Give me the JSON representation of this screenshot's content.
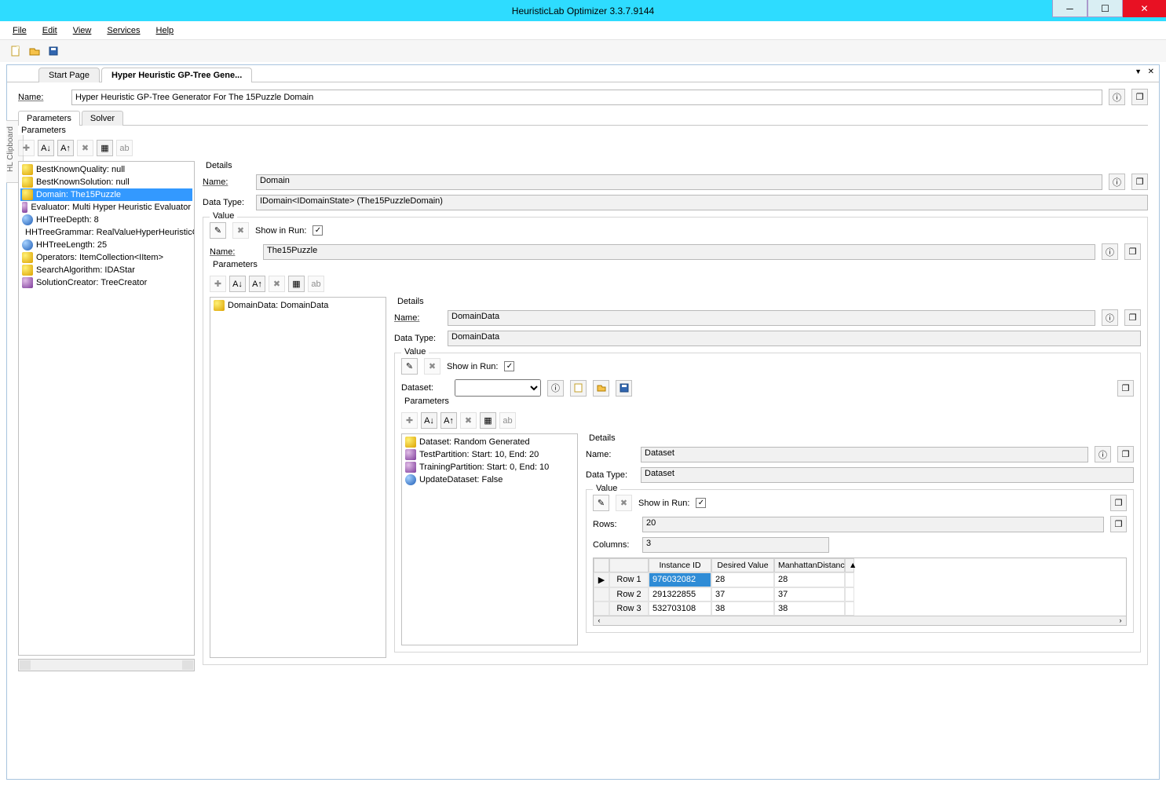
{
  "window": {
    "title": "HeuristicLab Optimizer 3.3.7.9144"
  },
  "menu": {
    "file": "File",
    "edit": "Edit",
    "view": "View",
    "services": "Services",
    "help": "Help"
  },
  "sidebar": {
    "clipboard": "HL Clipboard"
  },
  "tabs": {
    "start": "Start Page",
    "active": "Hyper Heuristic GP-Tree Gene..."
  },
  "form": {
    "name_label": "Name:",
    "name_value": "Hyper Heuristic GP-Tree Generator For The 15Puzzle Domain"
  },
  "subtabs": {
    "parameters": "Parameters",
    "solver": "Solver"
  },
  "params_header": "Parameters",
  "params_tree": [
    {
      "icon": "yellow",
      "text": "BestKnownQuality: null"
    },
    {
      "icon": "yellow",
      "text": "BestKnownSolution: null"
    },
    {
      "icon": "yellow",
      "text": "Domain: The15Puzzle",
      "selected": true
    },
    {
      "icon": "purple",
      "text": "Evaluator: Multi Hyper Heuristic Evaluator"
    },
    {
      "icon": "blue",
      "text": "HHTreeDepth: 8"
    },
    {
      "icon": "yellow",
      "text": "HHTreeGrammar: RealValueHyperHeuristicGra"
    },
    {
      "icon": "blue",
      "text": "HHTreeLength: 25"
    },
    {
      "icon": "yellow",
      "text": "Operators: ItemCollection<IItem>"
    },
    {
      "icon": "yellow",
      "text": "SearchAlgorithm: IDAStar"
    },
    {
      "icon": "purple",
      "text": "SolutionCreator: TreeCreator"
    }
  ],
  "details": {
    "legend": "Details",
    "name_label": "Name:",
    "name": "Domain",
    "datatype_label": "Data Type:",
    "datatype": "IDomain<IDomainState> (The15PuzzleDomain)",
    "value_legend": "Value",
    "show_in_run": "Show in Run:",
    "inner_name": "The15Puzzle",
    "params_legend": "Parameters"
  },
  "inner_tree": [
    {
      "icon": "yellow",
      "text": "DomainData: DomainData"
    }
  ],
  "inner_details": {
    "legend": "Details",
    "name_label": "Name:",
    "name": "DomainData",
    "datatype_label": "Data Type:",
    "datatype": "DomainData",
    "value_legend": "Value",
    "show_in_run": "Show in Run:",
    "dataset_label": "Dataset:",
    "params_legend": "Parameters"
  },
  "deep_tree": [
    {
      "icon": "yellow",
      "text": "Dataset: Random Generated"
    },
    {
      "icon": "purple",
      "text": "TestPartition: Start: 10, End: 20"
    },
    {
      "icon": "purple",
      "text": "TrainingPartition: Start: 0, End: 10"
    },
    {
      "icon": "blue",
      "text": "UpdateDataset: False"
    }
  ],
  "dataset_details": {
    "legend": "Details",
    "name_label": "Name:",
    "name": "Dataset",
    "datatype_label": "Data Type:",
    "datatype": "Dataset",
    "value_legend": "Value",
    "show_in_run": "Show in Run:",
    "rows_label": "Rows:",
    "rows": "20",
    "cols_label": "Columns:",
    "cols": "3"
  },
  "grid": {
    "headers": [
      "",
      "",
      "Instance ID",
      "Desired Value",
      "ManhattanDistance",
      "▲"
    ],
    "rows": [
      {
        "mark": "▶",
        "label": "Row 1",
        "id": "976032082",
        "dv": "28",
        "md": "28",
        "sel": true
      },
      {
        "mark": "",
        "label": "Row 2",
        "id": "291322855",
        "dv": "37",
        "md": "37"
      },
      {
        "mark": "",
        "label": "Row 3",
        "id": "532703108",
        "dv": "38",
        "md": "38"
      }
    ]
  }
}
